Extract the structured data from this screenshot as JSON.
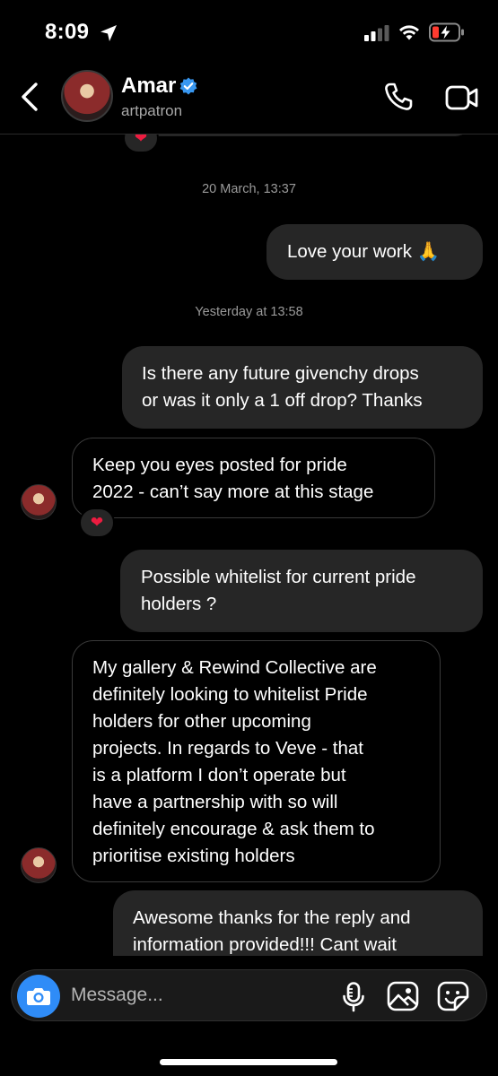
{
  "status_bar": {
    "time": "8:09"
  },
  "header": {
    "name": "Amar",
    "handle": "artpatron"
  },
  "messages": [
    {
      "type": "timestamp",
      "text": "20 March, 13:37"
    },
    {
      "type": "outgoing",
      "text": "Love your work 🙏"
    },
    {
      "type": "timestamp",
      "text": "Yesterday at 13:58"
    },
    {
      "type": "outgoing",
      "text": "Is there any future givenchy drops\nor was it only a 1 off drop? Thanks"
    },
    {
      "type": "incoming",
      "text": "Keep you eyes posted for pride\n2022 - can’t say more at this stage",
      "reaction": "❤"
    },
    {
      "type": "outgoing",
      "text": "Possible whitelist for current pride\nholders ?"
    },
    {
      "type": "incoming",
      "text": "My gallery & Rewind Collective are\ndefinitely looking to whitelist Pride\nholders for other upcoming\nprojects. In regards to Veve - that\nis a platform I don’t operate but\nhave a partnership with so will\ndefinitely encourage & ask them to\nprioritise existing holders"
    },
    {
      "type": "outgoing",
      "text": "Awesome thanks for the reply and\ninformation provided!!! Cant wait\nfor future drops! Keep the grind"
    }
  ],
  "top_reaction": "❤",
  "composer": {
    "placeholder": "Message..."
  },
  "colors": {
    "accent_blue": "#2f8cf7",
    "bubble": "#262626",
    "heart": "#ed1c40",
    "battery_low": "#ff3b30"
  },
  "icons": [
    "location-arrow-icon",
    "signal-icon",
    "wifi-icon",
    "battery-icon",
    "back-chevron-icon",
    "verified-badge-icon",
    "phone-icon",
    "video-camera-icon",
    "camera-icon",
    "microphone-icon",
    "gallery-icon",
    "sticker-icon"
  ]
}
